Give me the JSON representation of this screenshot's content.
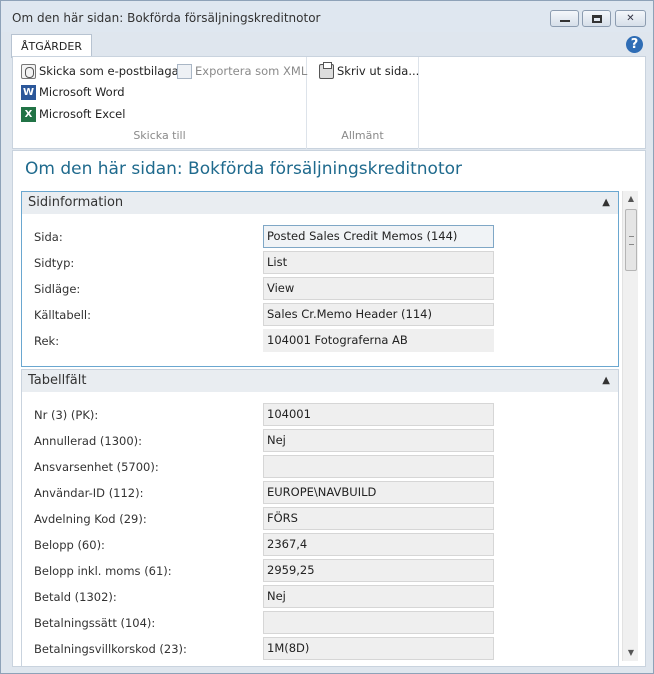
{
  "window": {
    "title": "Om den här sidan: Bokförda försäljningskreditnotor"
  },
  "ribbon": {
    "tab_label": "ÅTGÄRDER",
    "help_glyph": "?",
    "group_send": {
      "label": "Skicka till",
      "email": "Skicka som e-postbilaga",
      "xml": "Exportera som XML",
      "word": "Microsoft Word",
      "excel": "Microsoft Excel"
    },
    "group_general": {
      "label": "Allmänt",
      "print": "Skriv ut sida..."
    }
  },
  "page": {
    "title": "Om den här sidan: Bokförda försäljningskreditnotor",
    "page_info": {
      "header": "Sidinformation",
      "rows": [
        {
          "label": "Sida:",
          "value": "Posted Sales Credit Memos (144)"
        },
        {
          "label": "Sidtyp:",
          "value": "List"
        },
        {
          "label": "Sidläge:",
          "value": "View"
        },
        {
          "label": "Källtabell:",
          "value": "Sales Cr.Memo Header (114)"
        },
        {
          "label": "Rek:",
          "value": "104001 Fotograferna AB"
        }
      ]
    },
    "table_fields": {
      "header": "Tabellfält",
      "rows": [
        {
          "label": "Nr (3) (PK):",
          "value": "104001"
        },
        {
          "label": "Annullerad (1300):",
          "value": "Nej"
        },
        {
          "label": "Ansvarsenhet (5700):",
          "value": ""
        },
        {
          "label": "Användar-ID (112):",
          "value": "EUROPE\\NAVBUILD"
        },
        {
          "label": "Avdelning Kod (29):",
          "value": "FÖRS"
        },
        {
          "label": "Belopp (60):",
          "value": "2367,4"
        },
        {
          "label": "Belopp inkl. moms (61):",
          "value": "2959,25"
        },
        {
          "label": "Betald (1302):",
          "value": "Nej"
        },
        {
          "label": "Betalningssätt (104):",
          "value": ""
        },
        {
          "label": "Betalningsvillkorskod (23):",
          "value": "1M(8D)"
        }
      ]
    }
  },
  "colors": {
    "title_accent": "#1f6a8d",
    "help_blue": "#2f6db5",
    "word_blue": "#2b579a",
    "excel_green": "#217346"
  }
}
